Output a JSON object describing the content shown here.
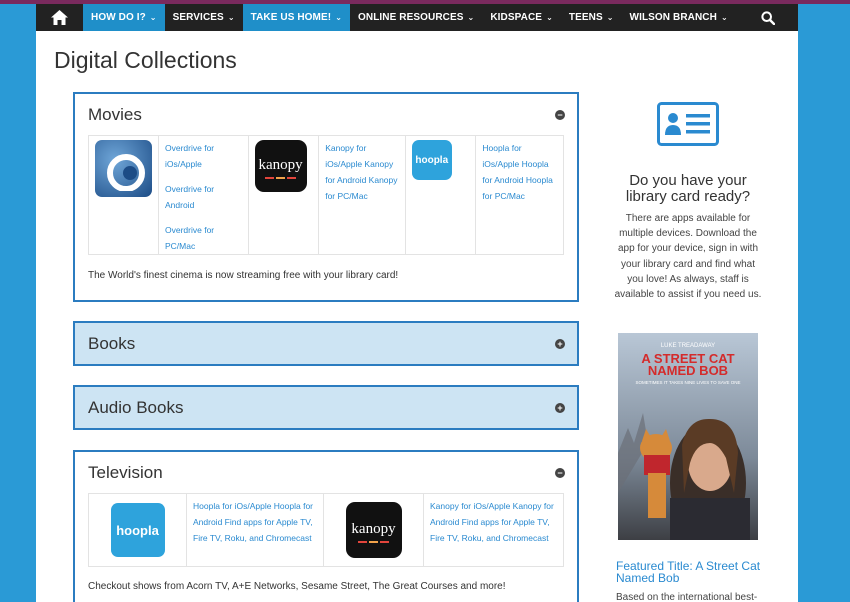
{
  "nav": {
    "items": [
      {
        "label": "HOW DO I?",
        "active": true,
        "chevron": true
      },
      {
        "label": "SERVICES",
        "active": false,
        "chevron": true
      },
      {
        "label": "TAKE US HOME!",
        "active": true,
        "chevron": true
      },
      {
        "label": "ONLINE RESOURCES",
        "active": false,
        "chevron": true
      },
      {
        "label": "KIDSPACE",
        "active": false,
        "chevron": true
      },
      {
        "label": "TEENS",
        "active": false,
        "chevron": true
      },
      {
        "label": "WILSON BRANCH",
        "active": false,
        "chevron": true
      }
    ],
    "home_icon": "home-icon",
    "search_icon": "search-icon"
  },
  "page_title": "Digital Collections",
  "movies": {
    "title": "Movies",
    "overdrive_links": [
      "Overdrive for iOs/Apple",
      "Overdrive for Android",
      "Overdrive for PC/Mac"
    ],
    "kanopy_links": [
      "Kanopy for iOs/Apple Kanopy for Android Kanopy for PC/Mac"
    ],
    "hoopla_links": [
      "Hoopla for iOs/Apple Hoopla for Android Hoopla for PC/Mac"
    ],
    "description": "The World's finest cinema is now streaming free with your library card!"
  },
  "books": {
    "title": "Books"
  },
  "audiobooks": {
    "title": "Audio Books"
  },
  "television": {
    "title": "Television",
    "hoopla_text": "Hoopla for iOs/Apple Hoopla for Android Find apps for Apple TV, Fire TV, Roku, and Chromecast",
    "kanopy_text": "Kanopy for iOs/Apple Kanopy for Android Find apps for Apple TV, Fire TV, Roku, and Chromecast",
    "description": "Checkout shows from Acorn TV, A+E Networks, Sesame Street, The Great Courses and more!"
  },
  "icons": {
    "kanopy_wordmark": "kanopy",
    "hoopla_wordmark": "hoopla"
  },
  "sidebar": {
    "heading": "Do you have your library card ready?",
    "text": "There are apps available for multiple devices.  Download the app for your device, sign in with your library card and find what you love!  As always, staff is available to assist if you need us.",
    "featured_link": "Featured Title: A Street Cat Named Bob",
    "featured_text": "Based on the international best-"
  },
  "poster": {
    "actor": "LUKE TREADAWAY",
    "title_line1": "A STREET CAT",
    "title_line2": "NAMED BOB",
    "tagline": "SOMETIMES IT TAKES NINE LIVES TO SAVE ONE"
  },
  "colors": {
    "nav_bg": "#222222",
    "nav_active": "#1f8fc9",
    "accent_blue": "#2b7cc0",
    "link": "#2a8ad0",
    "collapsed_bg": "#cde4f3",
    "page_bg": "#2a9ad6"
  }
}
